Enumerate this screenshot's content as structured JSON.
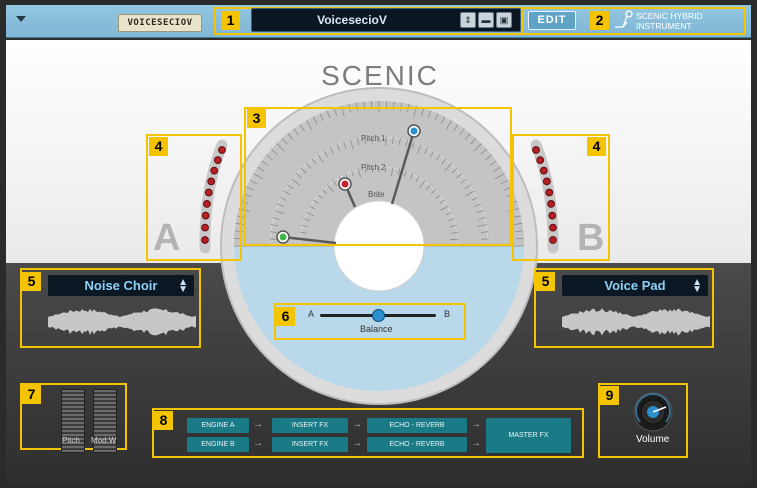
{
  "topbar": {
    "preset_tag": "VOICESECIOV",
    "preset_name": "VoicesecioV",
    "edit_label": "EDIT",
    "brand_line1": "SCENIC HYBRID",
    "brand_line2": "INSTRUMENT"
  },
  "title": "SCENIC",
  "callouts": [
    "1",
    "2",
    "3",
    "4",
    "4",
    "5",
    "5",
    "6",
    "7",
    "8",
    "9"
  ],
  "dial": {
    "labels": [
      "Pitch 1",
      "Pitch 2",
      "Brite"
    ]
  },
  "layer_a": {
    "letter": "A",
    "sample": "Noise Choir"
  },
  "layer_b": {
    "letter": "B",
    "sample": "Voice Pad"
  },
  "balance": {
    "left": "A",
    "right": "B",
    "label": "Balance",
    "value": 0.5
  },
  "faders": {
    "pitch": "Pitch",
    "modw": "Mod.W"
  },
  "fx_chain": {
    "row_a": [
      "ENGINE A",
      "INSERT FX",
      "ECHO - REVERB"
    ],
    "row_b": [
      "ENGINE B",
      "INSERT FX",
      "ECHO - REVERB"
    ],
    "master": "MASTER FX"
  },
  "volume": {
    "label": "Volume"
  },
  "colors": {
    "highlight": "#f5c400",
    "accent": "#5fa4c7",
    "bar": "#8cc2de"
  }
}
